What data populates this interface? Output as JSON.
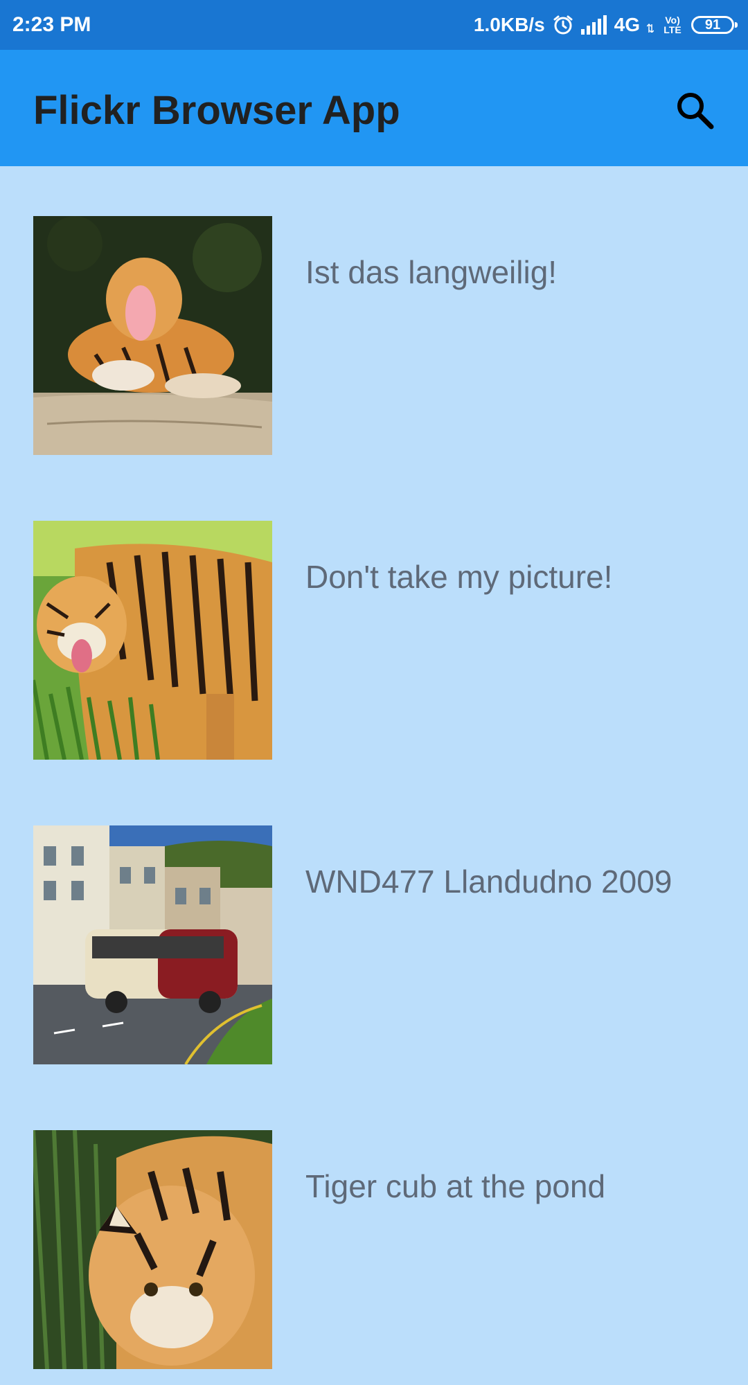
{
  "status_bar": {
    "time": "2:23 PM",
    "network_speed": "1.0KB/s",
    "network_type": "4G",
    "volte_label": "Vo) LTE",
    "battery": "91",
    "icons": [
      "alarm-icon",
      "signal-icon",
      "data-arrows-icon",
      "volte-icon",
      "battery-icon"
    ]
  },
  "app_bar": {
    "title": "Flickr Browser App",
    "search_icon": "search-icon"
  },
  "photos": [
    {
      "title": "Ist das langweilig!",
      "image": "yawning tiger lying on log"
    },
    {
      "title": "Don't take my picture!",
      "image": "snarling tiger in grass"
    },
    {
      "title": "WND477 Llandudno 2009",
      "image": "vintage red and cream bus on seaside street"
    },
    {
      "title": "Tiger cub at the pond",
      "image": "tiger cub near pond"
    }
  ],
  "colors": {
    "status_bar": "#1976D2",
    "app_bar": "#2196F3",
    "background": "#BBDEFB",
    "title_text": "#212121",
    "item_text": "#5E6978"
  }
}
